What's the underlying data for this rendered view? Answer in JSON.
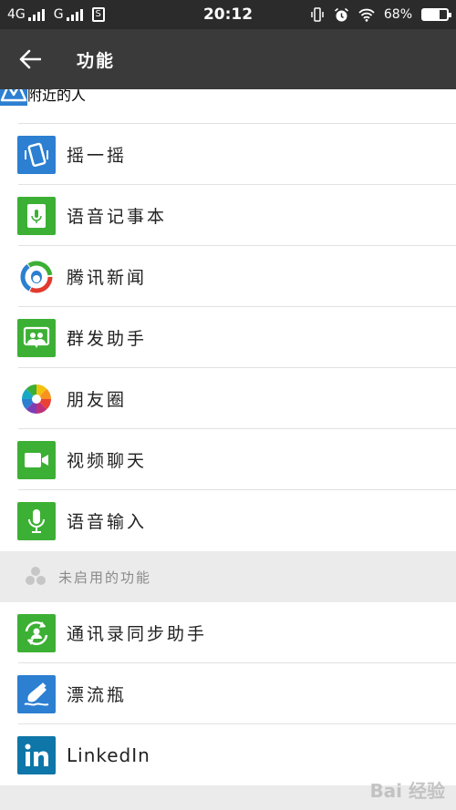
{
  "status_bar": {
    "network1": "4G",
    "network2": "G",
    "time": "20:12",
    "battery": "68%",
    "battery_level": 0.68
  },
  "app_bar": {
    "title": "功能"
  },
  "enabled_features": [
    {
      "label": "附近的人",
      "icon": "people-nearby-icon"
    },
    {
      "label": "摇一摇",
      "icon": "shake-phone-icon"
    },
    {
      "label": "语音记事本",
      "icon": "voice-notepad-icon"
    },
    {
      "label": "腾讯新闻",
      "icon": "tencent-news-icon"
    },
    {
      "label": "群发助手",
      "icon": "broadcast-assistant-icon"
    },
    {
      "label": "朋友圈",
      "icon": "moments-aperture-icon"
    },
    {
      "label": "视频聊天",
      "icon": "video-camera-icon"
    },
    {
      "label": "语音输入",
      "icon": "microphone-icon"
    }
  ],
  "disabled_section": {
    "title": "未启用的功能",
    "items": [
      {
        "label": "通讯录同步助手",
        "icon": "contact-sync-icon"
      },
      {
        "label": "漂流瓶",
        "icon": "drift-bottle-icon"
      },
      {
        "label": "LinkedIn",
        "icon": "linkedin-icon"
      }
    ]
  },
  "watermark": "Bai 经验",
  "colors": {
    "status_bar": "#2b2b2b",
    "app_bar": "#3a3a3a",
    "green": "#3cb034",
    "blue": "#2c7fd1",
    "linkedin_blue": "#0e76a8"
  }
}
